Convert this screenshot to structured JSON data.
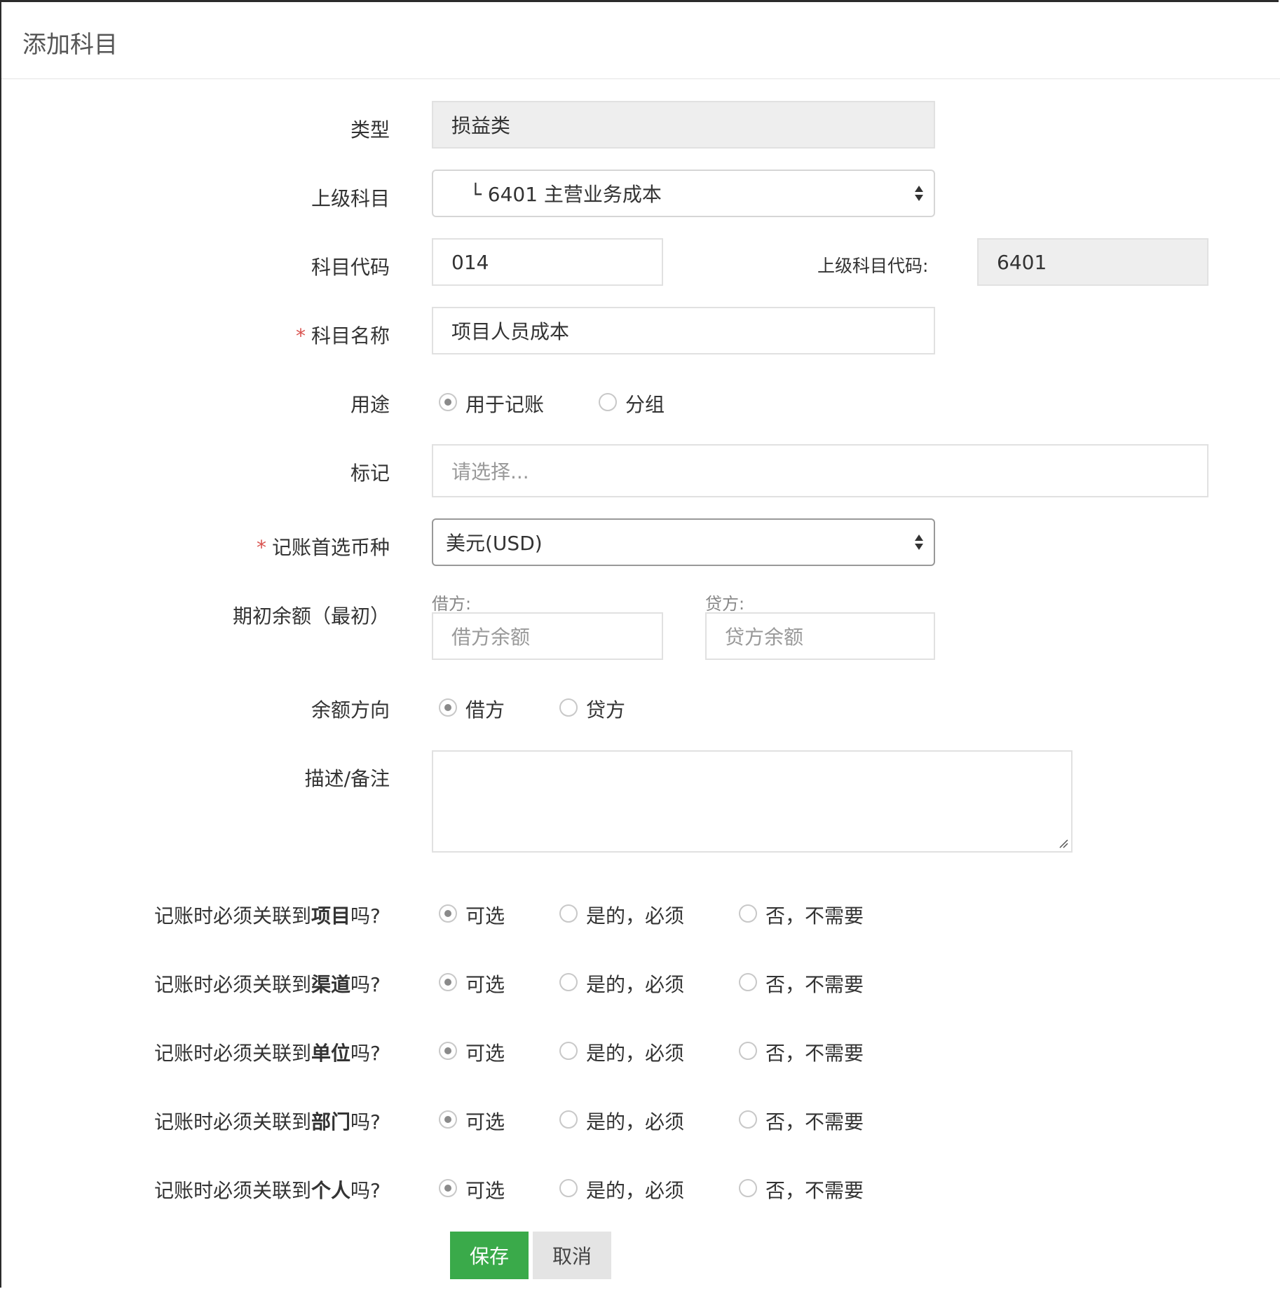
{
  "modal": {
    "title": "添加科目"
  },
  "form": {
    "type": {
      "label": "类型",
      "value": "损益类"
    },
    "parent_account": {
      "label": "上级科目",
      "value": "└ 6401 主营业务成本"
    },
    "account_code": {
      "label": "科目代码",
      "value": "014"
    },
    "parent_code": {
      "label": "上级科目代码:",
      "value": "6401"
    },
    "account_name": {
      "label": "科目名称",
      "required_mark": "*",
      "value": "项目人员成本"
    },
    "usage": {
      "label": "用途",
      "options": [
        "用于记账",
        "分组"
      ],
      "selected": "用于记账"
    },
    "tags": {
      "label": "标记",
      "placeholder": "请选择..."
    },
    "currency": {
      "label": "记账首选币种",
      "required_mark": "*",
      "value": "美元(USD)"
    },
    "opening_balance": {
      "label": "期初余额（最初）",
      "debit_label": "借方:",
      "debit_placeholder": "借方余额",
      "credit_label": "贷方:",
      "credit_placeholder": "贷方余额"
    },
    "balance_direction": {
      "label": "余额方向",
      "options": [
        "借方",
        "贷方"
      ],
      "selected": "借方"
    },
    "description": {
      "label": "描述/备注",
      "value": ""
    },
    "link_options": [
      "可选",
      "是的，必须",
      "否，不需要"
    ],
    "link_questions": [
      {
        "prefix": "记账时必须关联到",
        "target": "项目",
        "suffix": "吗?",
        "selected": "可选"
      },
      {
        "prefix": "记账时必须关联到",
        "target": "渠道",
        "suffix": "吗?",
        "selected": "可选"
      },
      {
        "prefix": "记账时必须关联到",
        "target": "单位",
        "suffix": "吗?",
        "selected": "可选"
      },
      {
        "prefix": "记账时必须关联到",
        "target": "部门",
        "suffix": "吗?",
        "selected": "可选"
      },
      {
        "prefix": "记账时必须关联到",
        "target": "个人",
        "suffix": "吗?",
        "selected": "可选"
      }
    ]
  },
  "buttons": {
    "save": "保存",
    "cancel": "取消"
  },
  "colors": {
    "primary": "#3aaa4a",
    "required": "#d9534f",
    "readonly_bg": "#eeeeee"
  }
}
